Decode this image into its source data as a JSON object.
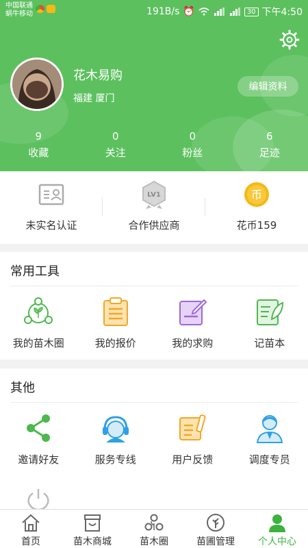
{
  "statusbar": {
    "carrier_line1": "中国联通",
    "carrier_line2": "蜗牛移动",
    "speed": "191B/s",
    "battery": "30",
    "time": "下午4:50"
  },
  "profile": {
    "username": "花木易购",
    "location": "福建 厦门",
    "edit_label": "编辑资料"
  },
  "stats": [
    {
      "value": "9",
      "label": "收藏"
    },
    {
      "value": "0",
      "label": "关注"
    },
    {
      "value": "0",
      "label": "粉丝"
    },
    {
      "value": "6",
      "label": "足迹"
    }
  ],
  "badges": [
    {
      "label": "未实名认证",
      "icon": "id-card-icon"
    },
    {
      "label": "合作供应商",
      "icon": "level-medal-icon",
      "icon_text": "LV1"
    },
    {
      "label": "花币159",
      "icon": "coin-icon",
      "icon_text": "币"
    }
  ],
  "tools": {
    "title": "常用工具",
    "items": [
      {
        "label": "我的苗木圈",
        "icon": "circle-network-icon"
      },
      {
        "label": "我的报价",
        "icon": "clipboard-icon"
      },
      {
        "label": "我的求购",
        "icon": "edit-note-icon"
      },
      {
        "label": "记苗本",
        "icon": "notebook-leaf-icon"
      }
    ]
  },
  "others": {
    "title": "其他",
    "items": [
      {
        "label": "邀请好友",
        "icon": "share-icon"
      },
      {
        "label": "服务专线",
        "icon": "headset-icon"
      },
      {
        "label": "用户反馈",
        "icon": "feedback-icon"
      },
      {
        "label": "调度专员",
        "icon": "agent-icon"
      }
    ]
  },
  "nav": [
    {
      "label": "首页",
      "icon": "home-icon"
    },
    {
      "label": "苗木商城",
      "icon": "shop-icon"
    },
    {
      "label": "苗木圈",
      "icon": "circle-icon"
    },
    {
      "label": "苗圃管理",
      "icon": "tree-icon"
    },
    {
      "label": "个人中心",
      "icon": "person-icon",
      "active": true
    }
  ],
  "colors": {
    "header_green": "#5cc05e",
    "active_green": "#3db23f",
    "orange": "#f5a623",
    "purple": "#a067d8",
    "blue": "#2ea0e6",
    "gold": "#f5b914"
  }
}
